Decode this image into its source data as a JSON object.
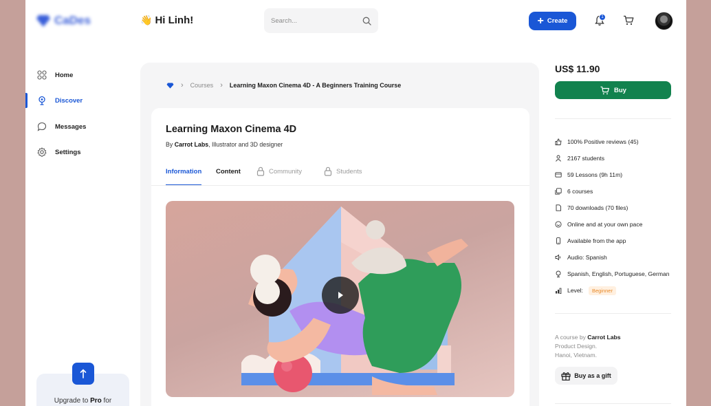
{
  "header": {
    "logo_text": "CaDes",
    "greeting_emoji": "👋",
    "greeting": "Hi Linh!",
    "search_placeholder": "Search...",
    "create_label": "Create",
    "notification_count": "1"
  },
  "sidebar": {
    "items": [
      {
        "label": "Home",
        "icon": "grid-icon"
      },
      {
        "label": "Discover",
        "icon": "discover-icon",
        "active": true
      },
      {
        "label": "Messages",
        "icon": "chat-icon"
      },
      {
        "label": "Settings",
        "icon": "gear-icon"
      }
    ],
    "upgrade_prefix": "Upgrade to ",
    "upgrade_pro": "Pro",
    "upgrade_suffix": " for"
  },
  "breadcrumb": {
    "courses": "Courses",
    "current": "Learning Maxon Cinema 4D - A Beginners Training Course"
  },
  "course": {
    "title": "Learning Maxon Cinema 4D",
    "by_prefix": "By ",
    "author": "Carrot Labs",
    "author_role": ", Illustrator and 3D designer",
    "tabs": [
      {
        "label": "Information",
        "state": "active"
      },
      {
        "label": "Content",
        "state": "normal"
      },
      {
        "label": "Community",
        "state": "locked"
      },
      {
        "label": "Students",
        "state": "locked"
      }
    ]
  },
  "purchase": {
    "price": "US$ 11.90",
    "buy_label": "Buy",
    "features": [
      {
        "icon": "thumbs-up-icon",
        "text": "100% Positive reviews (45)"
      },
      {
        "icon": "user-icon",
        "text": "2167 students"
      },
      {
        "icon": "video-icon",
        "text": "59 Lessons (9h 11m)"
      },
      {
        "icon": "courses-icon",
        "text": "6 courses"
      },
      {
        "icon": "file-icon",
        "text": "70 downloads (70 files)"
      },
      {
        "icon": "pace-icon",
        "text": "Online and at your own pace"
      },
      {
        "icon": "phone-icon",
        "text": "Available from the app"
      },
      {
        "icon": "speaker-icon",
        "text": "Audio: Spanish"
      },
      {
        "icon": "globe-icon",
        "text": "Spanish, English, Portuguese, German"
      },
      {
        "icon": "level-icon",
        "text": "Level:"
      }
    ],
    "level_value": "Beginner",
    "author_prefix": "A course by ",
    "author_name": "Carrot Labs",
    "author_line2": "Product Design.",
    "author_line3": "Hanoi, Vietnam.",
    "gift_label": "Buy as a gift"
  },
  "colors": {
    "accent": "#1a57d6",
    "buy": "#12824e",
    "background": "#c5a09a",
    "level_badge": "#e88a2a"
  }
}
